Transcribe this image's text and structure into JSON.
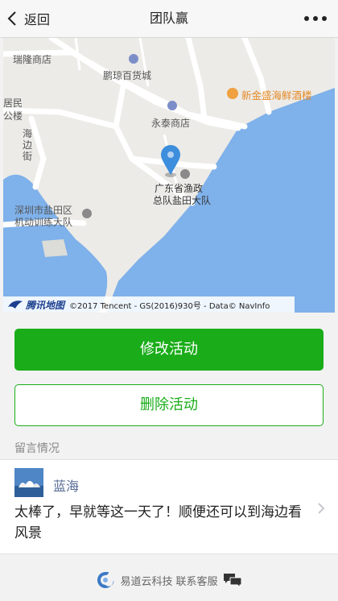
{
  "nav": {
    "back_label": "返回",
    "title": "团队赢"
  },
  "map": {
    "labels": {
      "ruilong": "瑞隆商店",
      "pengcong": "鹏琼百货城",
      "xinjinsheng": "新金盛海鲜酒楼",
      "yongtai": "永泰商店",
      "jumin": "居民",
      "gonglou": "公楼",
      "haibian": "海边街",
      "fishery": "广东省渔政",
      "fishery2": "总队盐田大队",
      "yantian": "深圳市盐田区",
      "jidong": "机动训练大队"
    },
    "credit_logo": "腾讯地图",
    "credit_text": "©2017 Tencent - GS(2016)930号 - Data© NavInfo"
  },
  "actions": {
    "modify": "修改活动",
    "delete": "删除活动"
  },
  "comments": {
    "section_title": "留言情况",
    "items": [
      {
        "name": "蓝海",
        "text": "太棒了，早就等这一天了！顺便还可以到海边看风景"
      }
    ]
  },
  "footer": {
    "brand": "易道云科技",
    "service": "联系客服"
  },
  "colors": {
    "primary": "#1aad19",
    "water": "#7fb1ea",
    "pin": "#3d8edc",
    "link": "#576b95"
  }
}
